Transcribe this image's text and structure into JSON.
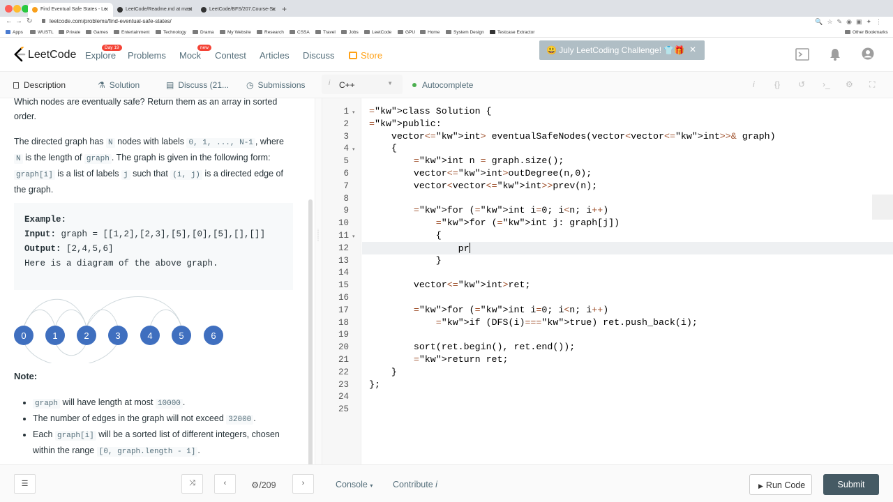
{
  "browser": {
    "tabs": [
      {
        "title": "Find Eventual Safe States - Le"
      },
      {
        "title": "LeetCode/Readme.md at mast"
      },
      {
        "title": "LeetCode/BFS/207.Course-Sc"
      }
    ],
    "url": "leetcode.com/problems/find-eventual-safe-states/",
    "bookmarks": [
      "Apps",
      "WUSTL",
      "Private",
      "Games",
      "Entertainment",
      "Technology",
      "Drama",
      "My Website",
      "Research",
      "CSSA",
      "Travel",
      "Jobs",
      "LeetCode",
      "GPU",
      "Home",
      "System Design",
      "Testcase Extractor"
    ],
    "other_bookmarks": "Other Bookmarks"
  },
  "header": {
    "logo": "LeetCode",
    "nav": [
      {
        "label": "Explore",
        "badge": "Day 19"
      },
      {
        "label": "Problems",
        "badge": ""
      },
      {
        "label": "Mock",
        "badge": "new"
      },
      {
        "label": "Contest",
        "badge": ""
      },
      {
        "label": "Articles",
        "badge": ""
      },
      {
        "label": "Discuss",
        "badge": ""
      },
      {
        "label": "Store",
        "badge": ""
      }
    ],
    "challenge": "😃 July LeetCoding Challenge! 👕🎁"
  },
  "tabs": {
    "description": "Description",
    "solution": "Solution",
    "discuss": "Discuss (21...",
    "submissions": "Submissions",
    "language": "C++",
    "autocomplete": "Autocomplete"
  },
  "description": {
    "intro": "Which nodes are eventually safe?  Return them as an array in sorted order.",
    "p2_a": "The directed graph has ",
    "p2_N": "N",
    "p2_b": " nodes with labels ",
    "p2_labels": "0, 1, ..., N-1",
    "p2_c": ", where ",
    "p2_N2": "N",
    "p2_d": " is the length of ",
    "p2_graph": "graph",
    "p2_e": ". The graph is given in the following form: ",
    "p2_graphi": "graph[i]",
    "p2_f": " is a list of labels ",
    "p2_j": "j",
    "p2_g": " such that ",
    "p2_ij": "(i, j)",
    "p2_h": " is a directed edge of the graph.",
    "example_title": "Example:",
    "example_input_label": "Input:",
    "example_input": " graph = [[1,2],[2,3],[5],[0],[5],[],[]]",
    "example_output_label": "Output:",
    "example_output": " [2,4,5,6]",
    "example_note": "Here is a diagram of the above graph.",
    "nodes": [
      "0",
      "1",
      "2",
      "3",
      "4",
      "5",
      "6"
    ],
    "note_title": "Note:",
    "notes": [
      {
        "code": "graph",
        "text": " will have length at most ",
        "code2": "10000",
        "tail": "."
      },
      {
        "code": "",
        "text": "The number of edges in the graph will not exceed ",
        "code2": "32000",
        "tail": "."
      },
      {
        "code": "graph[i]",
        "text_pre": "Each ",
        "text": " will be a sorted list of different integers, chosen within the range ",
        "code2": "[0, graph.length - 1]",
        "tail": "."
      }
    ]
  },
  "editor": {
    "line_numbers": [
      "1",
      "2",
      "3",
      "4",
      "5",
      "6",
      "7",
      "8",
      "9",
      "10",
      "11",
      "12",
      "13",
      "14",
      "15",
      "16",
      "17",
      "18",
      "19",
      "20",
      "21",
      "22",
      "23",
      "24",
      "25"
    ],
    "lines": [
      "class Solution {",
      "public:",
      "    vector<int> eventualSafeNodes(vector<vector<int>>& graph)",
      "    {",
      "        int n = graph.size();",
      "        vector<int>outDegree(n,0);",
      "        vector<vector<int>>prev(n);",
      "",
      "        for (int i=0; i<n; i++)",
      "            for (int j: graph[j])",
      "            {",
      "                pr",
      "            }",
      "",
      "        vector<int>ret;",
      "",
      "        for (int i=0; i<n; i++)",
      "            if (DFS(i)==true) ret.push_back(i);",
      "",
      "        sort(ret.begin(), ret.end());",
      "        return ret;",
      "    }",
      "};",
      "",
      ""
    ]
  },
  "footer": {
    "count": "/209",
    "console": "Console",
    "contribute": "Contribute",
    "run": "Run Code",
    "submit": "Submit"
  }
}
